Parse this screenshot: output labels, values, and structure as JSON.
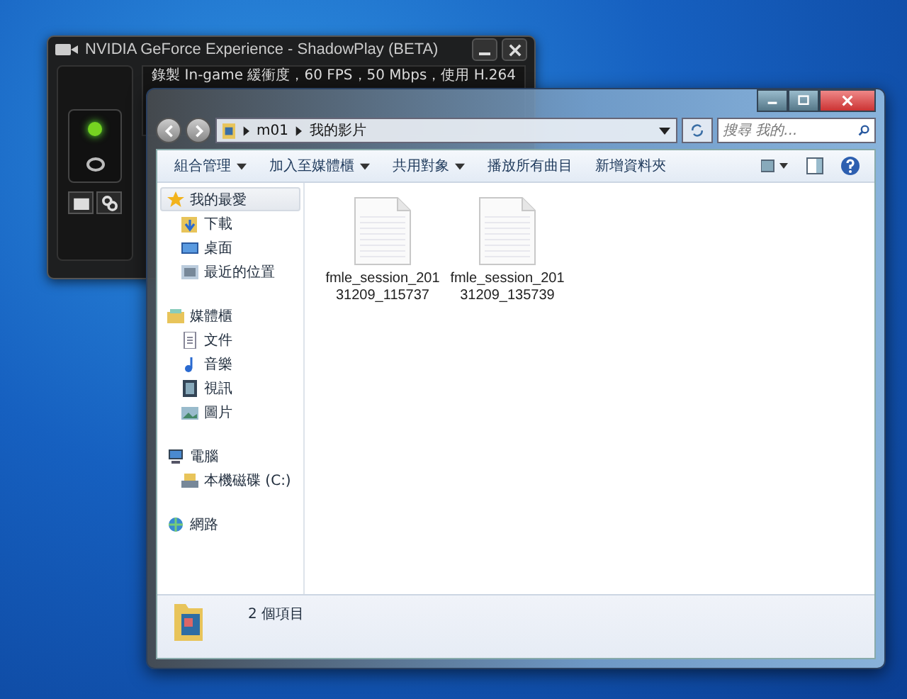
{
  "shadowplay": {
    "title": "NVIDIA GeForce Experience - ShadowPlay (BETA)",
    "status": "錄製 In-game 緩衝度，60 FPS，50 Mbps，使用 H.264",
    "recording_on": true
  },
  "explorer": {
    "path": [
      "m01",
      "我的影片"
    ],
    "search": {
      "placeholder": "搜尋 我的..."
    },
    "toolbar": [
      {
        "label": "組合管理",
        "dropdown": true
      },
      {
        "label": "加入至媒體櫃",
        "dropdown": true
      },
      {
        "label": "共用對象",
        "dropdown": true
      },
      {
        "label": "播放所有曲目",
        "dropdown": false
      },
      {
        "label": "新增資料夾",
        "dropdown": false
      }
    ],
    "nav": [
      {
        "label": "我的最愛",
        "kind": "star",
        "selected": true,
        "children": [
          {
            "label": "下載",
            "kind": "download",
            "selected": false
          },
          {
            "label": "桌面",
            "kind": "desktop",
            "selected": false
          },
          {
            "label": "最近的位置",
            "kind": "recent",
            "selected": false
          }
        ]
      },
      {
        "label": "媒體櫃",
        "kind": "library",
        "selected": false,
        "children": [
          {
            "label": "文件",
            "kind": "document",
            "selected": false
          },
          {
            "label": "音樂",
            "kind": "music",
            "selected": false
          },
          {
            "label": "視訊",
            "kind": "video",
            "selected": false
          },
          {
            "label": "圖片",
            "kind": "picture",
            "selected": false
          }
        ]
      },
      {
        "label": "電腦",
        "kind": "computer",
        "selected": false,
        "children": [
          {
            "label": "本機磁碟 (C:)",
            "kind": "drive",
            "selected": false
          }
        ]
      },
      {
        "label": "網路",
        "kind": "network",
        "selected": false
      }
    ],
    "files": [
      {
        "name": "fmle_session_20131209_115737"
      },
      {
        "name": "fmle_session_20131209_135739"
      }
    ],
    "status": "2 個項目"
  }
}
